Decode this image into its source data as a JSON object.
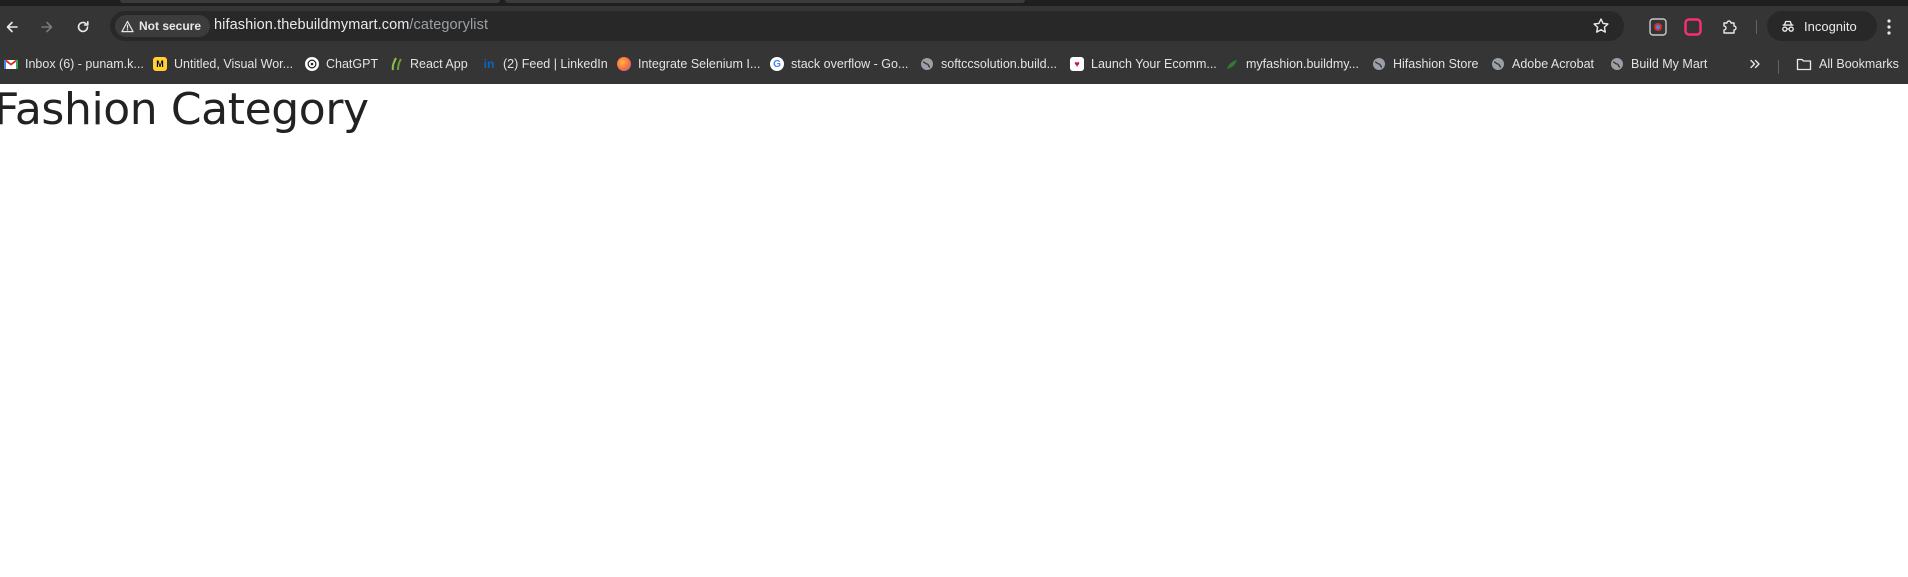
{
  "browser": {
    "security_label": "Not secure",
    "url_host": "hifashion.thebuildmymart.com",
    "url_path": "/categorylist",
    "profile_label": "Incognito"
  },
  "bookmarks": [
    {
      "label": "Inbox (6) - punam.k...",
      "icon": "gmail-icon"
    },
    {
      "label": "Untitled, Visual Wor...",
      "icon": "miro-icon"
    },
    {
      "label": "ChatGPT",
      "icon": "chatgpt-icon"
    },
    {
      "label": "React App",
      "icon": "react-app-icon"
    },
    {
      "label": "(2) Feed | LinkedIn",
      "icon": "linkedin-icon"
    },
    {
      "label": "Integrate Selenium I...",
      "icon": "firefox-icon"
    },
    {
      "label": "stack overflow - Go...",
      "icon": "google-icon"
    },
    {
      "label": "softccsolution.build...",
      "icon": "globe-icon"
    },
    {
      "label": "Launch Your Ecomm...",
      "icon": "store-icon"
    },
    {
      "label": "myfashion.buildmy...",
      "icon": "leaf-icon"
    },
    {
      "label": "Hifashion Store",
      "icon": "globe-icon"
    },
    {
      "label": "Adobe Acrobat",
      "icon": "globe-icon"
    },
    {
      "label": "Build My Mart",
      "icon": "globe-icon"
    }
  ],
  "all_bookmarks_label": "All Bookmarks",
  "page": {
    "title": "Fashion Category"
  },
  "colors": {
    "toolbar": "#353535",
    "omnibox": "#282828",
    "page_background": "#ffffff",
    "title_text": "#222222"
  }
}
